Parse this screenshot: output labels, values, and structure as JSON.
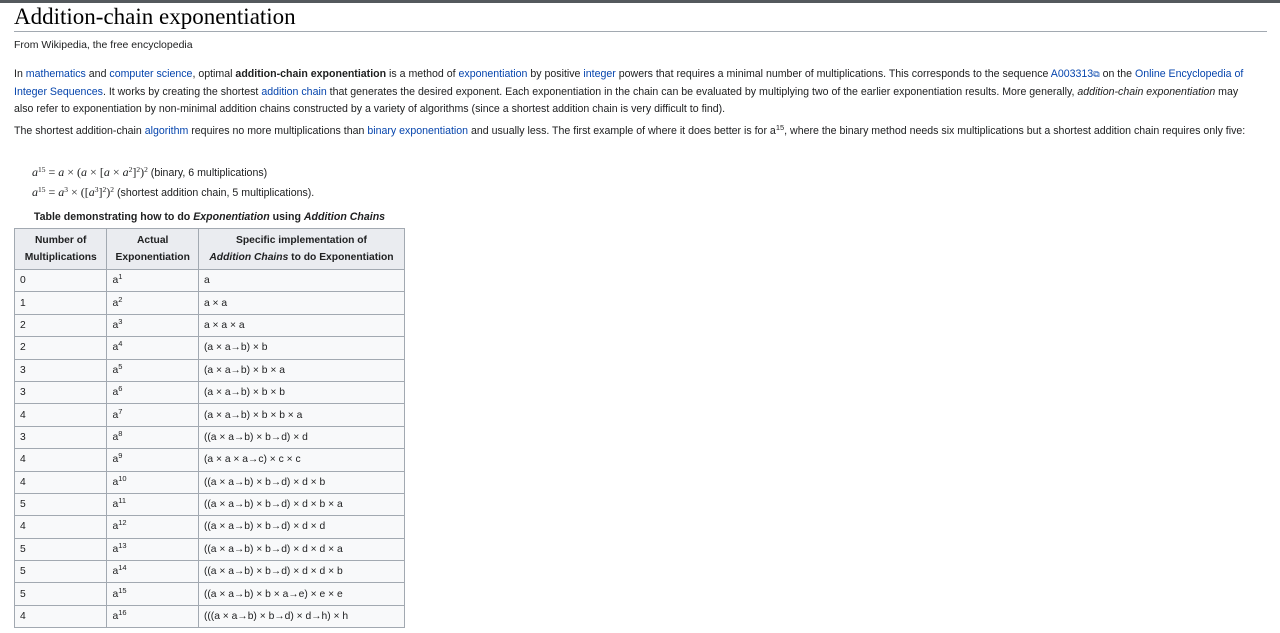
{
  "page": {
    "title": "Addition-chain exponentiation",
    "tagline": "From Wikipedia, the free encyclopedia"
  },
  "para1": {
    "t1": "In ",
    "link_math": "mathematics",
    "t2": " and ",
    "link_cs": "computer science",
    "t3": ", optimal ",
    "bold": "addition-chain exponentiation",
    "t4": " is a method of ",
    "link_exp": "exponentiation",
    "t5": " by positive ",
    "link_int": "integer",
    "t6": " powers that requires a minimal number of multiplications. This corresponds to the sequence ",
    "link_oeis_id": "A003313",
    "t7": " on the ",
    "link_oeis": "Online Encyclopedia of Integer Sequences",
    "t8": ". It works by creating the shortest ",
    "link_chain": "addition chain",
    "t9": " that generates the desired exponent. Each exponentiation in the chain can be evaluated by multiplying two of the earlier exponentiation results. More generally, ",
    "italic": "addition-chain exponentiation",
    "t10": " may also refer to exponentiation by non-minimal addition chains constructed by a variety of algorithms (since a shortest addition chain is very difficult to find)."
  },
  "para2": {
    "t1": "The shortest addition-chain ",
    "link_algo": "algorithm",
    "t2": " requires no more multiplications than ",
    "link_binexp": "binary exponentiation",
    "t3": " and usually less. The first example of where it does better is for a",
    "sup": "15",
    "t4": ", where the binary method needs six multiplications but a shortest addition chain requires only five:"
  },
  "formulas": {
    "f1_note": " (binary, 6 multiplications)",
    "f2_note": " (shortest addition chain, 5 multiplications)."
  },
  "table": {
    "caption_pre": "Table demonstrating how to do ",
    "caption_i1": "Exponentiation",
    "caption_mid": " using ",
    "caption_i2": "Addition Chains",
    "h1a": "Number of",
    "h1b": "Multiplications",
    "h2a": "Actual",
    "h2b": "Exponentiation",
    "h3a": "Specific implementation of",
    "h3b_i": "Addition Chains",
    "h3b_rest": " to do Exponentiation",
    "rows": [
      {
        "mult": "0",
        "base": "a",
        "exp": "1",
        "impl": "a"
      },
      {
        "mult": "1",
        "base": "a",
        "exp": "2",
        "impl": "a × a"
      },
      {
        "mult": "2",
        "base": "a",
        "exp": "3",
        "impl": "a × a × a"
      },
      {
        "mult": "2",
        "base": "a",
        "exp": "4",
        "impl": "(a × a→b) × b"
      },
      {
        "mult": "3",
        "base": "a",
        "exp": "5",
        "impl": "(a × a→b) × b × a"
      },
      {
        "mult": "3",
        "base": "a",
        "exp": "6",
        "impl": "(a × a→b) × b × b"
      },
      {
        "mult": "4",
        "base": "a",
        "exp": "7",
        "impl": "(a × a→b) × b × b × a"
      },
      {
        "mult": "3",
        "base": "a",
        "exp": "8",
        "impl": "((a × a→b) × b→d) × d"
      },
      {
        "mult": "4",
        "base": "a",
        "exp": "9",
        "impl": "(a × a × a→c) × c × c"
      },
      {
        "mult": "4",
        "base": "a",
        "exp": "10",
        "impl": "((a × a→b) × b→d) × d × b"
      },
      {
        "mult": "5",
        "base": "a",
        "exp": "11",
        "impl": "((a × a→b) × b→d) × d × b × a"
      },
      {
        "mult": "4",
        "base": "a",
        "exp": "12",
        "impl": "((a × a→b) × b→d) × d × d"
      },
      {
        "mult": "5",
        "base": "a",
        "exp": "13",
        "impl": "((a × a→b) × b→d) × d × d × a"
      },
      {
        "mult": "5",
        "base": "a",
        "exp": "14",
        "impl": "((a × a→b) × b→d) × d × d × b"
      },
      {
        "mult": "5",
        "base": "a",
        "exp": "15",
        "impl": "((a × a→b) × b × a→e) × e × e"
      },
      {
        "mult": "4",
        "base": "a",
        "exp": "16",
        "impl": "(((a × a→b) × b→d) × d→h) × h"
      }
    ]
  }
}
